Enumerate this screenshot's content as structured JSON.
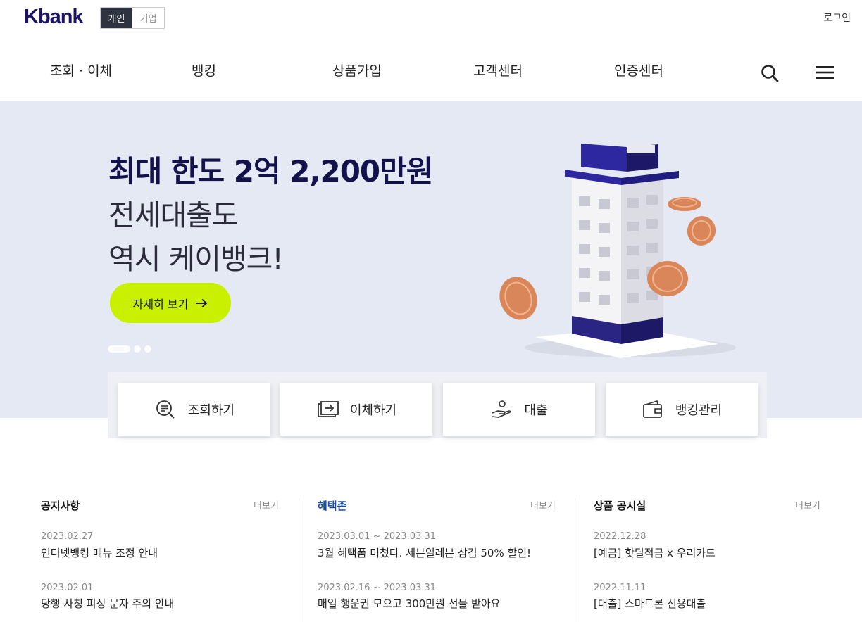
{
  "header": {
    "logo": "Kbank",
    "segments": [
      "개인",
      "기업"
    ],
    "login": "로그인"
  },
  "nav": {
    "items": [
      "조회 · 이체",
      "뱅킹",
      "상품가입",
      "고객센터",
      "인증센터"
    ]
  },
  "hero": {
    "title": "최대 한도 2억 2,200만원",
    "line1": "전세대출도",
    "line2": "역시 케이뱅크!",
    "cta": "자세히 보기",
    "accent": "#c9f000"
  },
  "quick": {
    "items": [
      "조회하기",
      "이체하기",
      "대출",
      "뱅킹관리"
    ]
  },
  "notices": {
    "title": "공지사항",
    "more": "더보기",
    "items": [
      {
        "date": "2023.02.27",
        "text": "인터넷뱅킹 메뉴 조정 안내"
      },
      {
        "date": "2023.02.01",
        "text": "당행 사칭 피싱 문자 주의 안내"
      }
    ]
  },
  "benefits": {
    "title": "혜택존",
    "more": "더보기",
    "items": [
      {
        "date": "2023.03.01 ~ 2023.03.31",
        "text": "3월 혜택폼 미쳤다. 세븐일레븐 삼김 50% 할인!"
      },
      {
        "date": "2023.02.16 ~ 2023.03.31",
        "text": "매일 행운권 모으고 300만원 선물 받아요"
      }
    ]
  },
  "products": {
    "title": "상품 공시실",
    "more": "더보기",
    "items": [
      {
        "date": "2022.12.28",
        "text": "[예금] 핫딜적금 x 우리카드"
      },
      {
        "date": "2022.11.11",
        "text": "[대출] 스마트론 신용대출"
      }
    ]
  }
}
